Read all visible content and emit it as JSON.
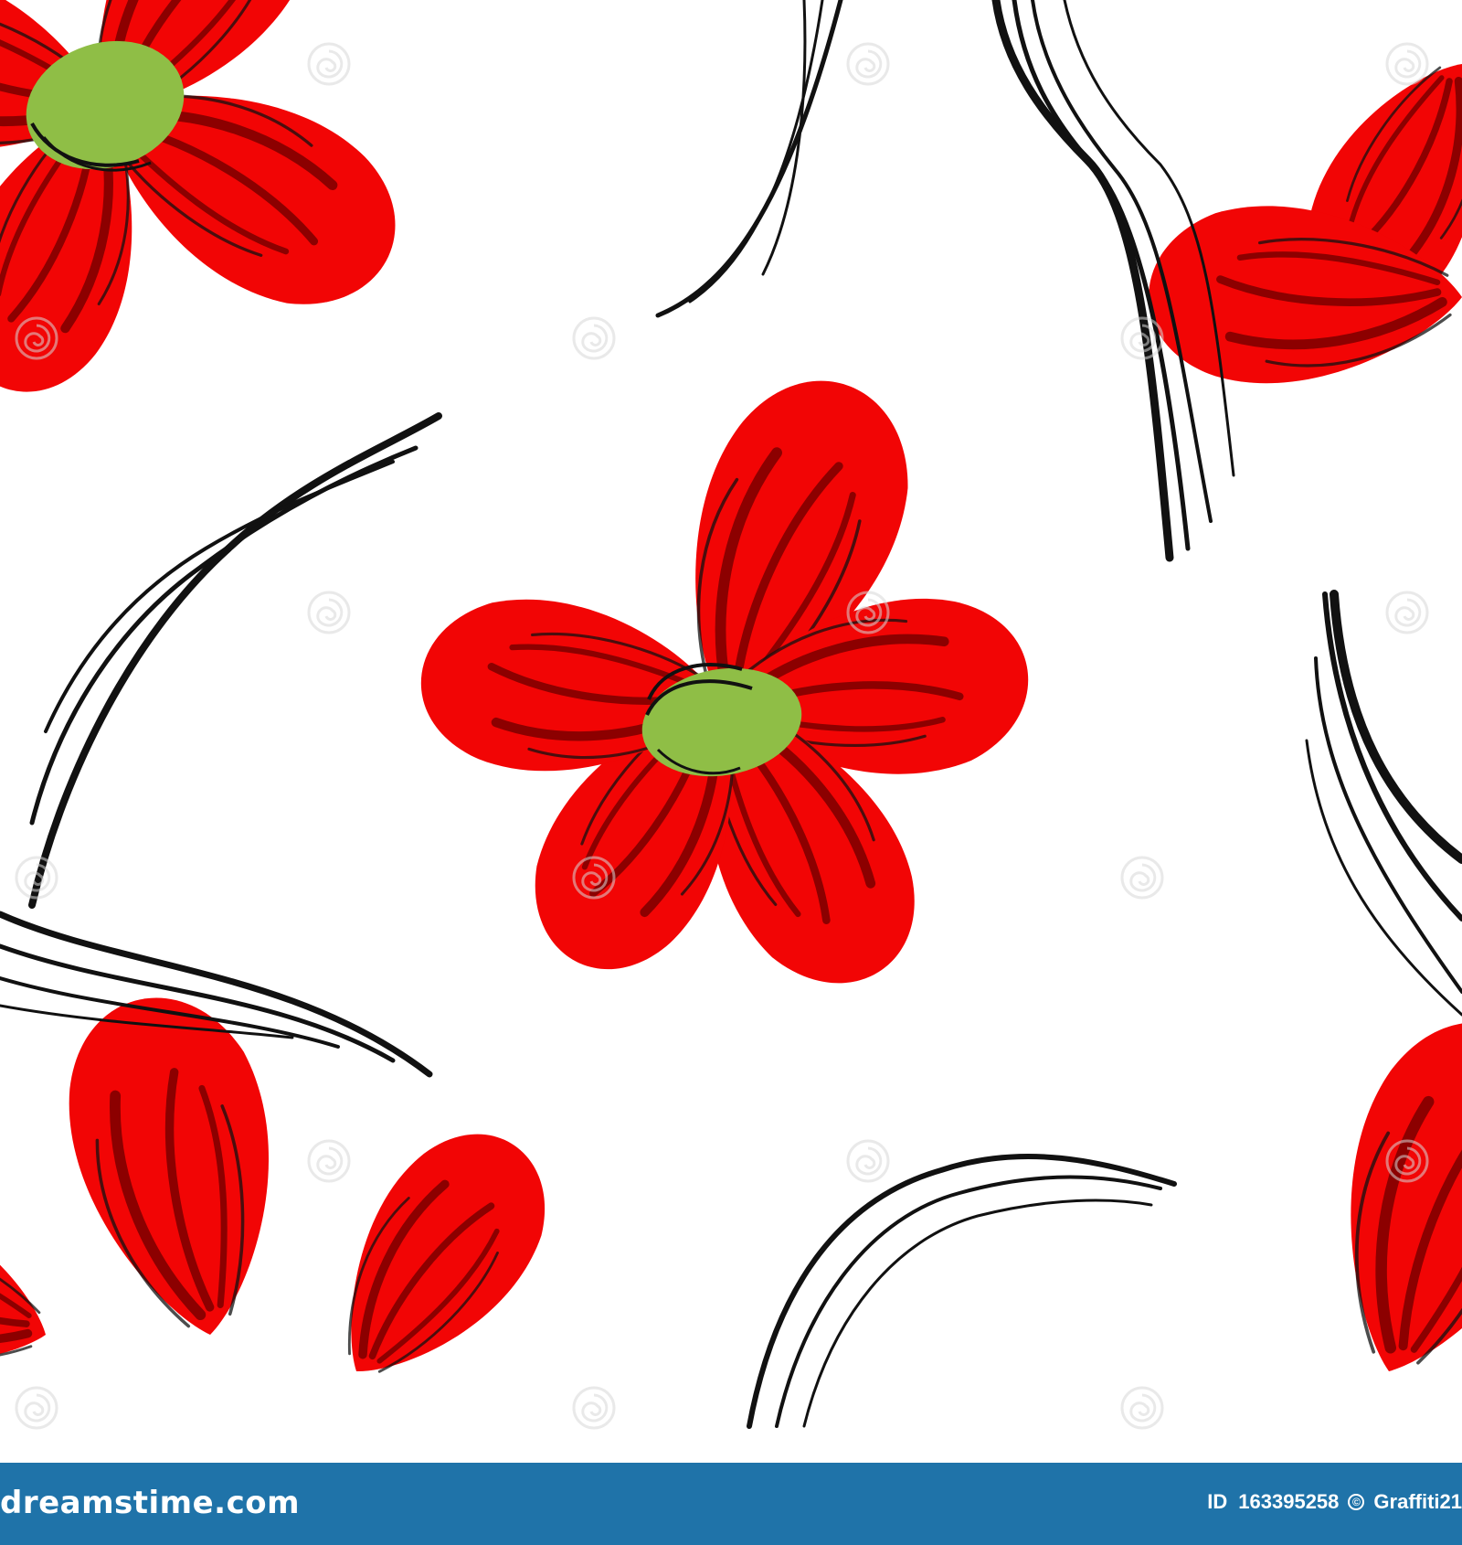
{
  "image": {
    "colors": {
      "background": "#ffffff",
      "petal_red": "#f20505",
      "petal_shade": "#8c0000",
      "center_green": "#8fbe46",
      "stroke_black": "#111111",
      "watermark": "#d7d7d7"
    },
    "icons": {
      "watermark": "spiral-watermark-icon",
      "copyright": "copyright-icon"
    }
  },
  "footer": {
    "brand": "dreamstime.com",
    "id_label": "ID",
    "id_value": "163395258",
    "copyright_symbol": "©",
    "author": "Graffiti21",
    "background_color": "#1f73a9"
  }
}
